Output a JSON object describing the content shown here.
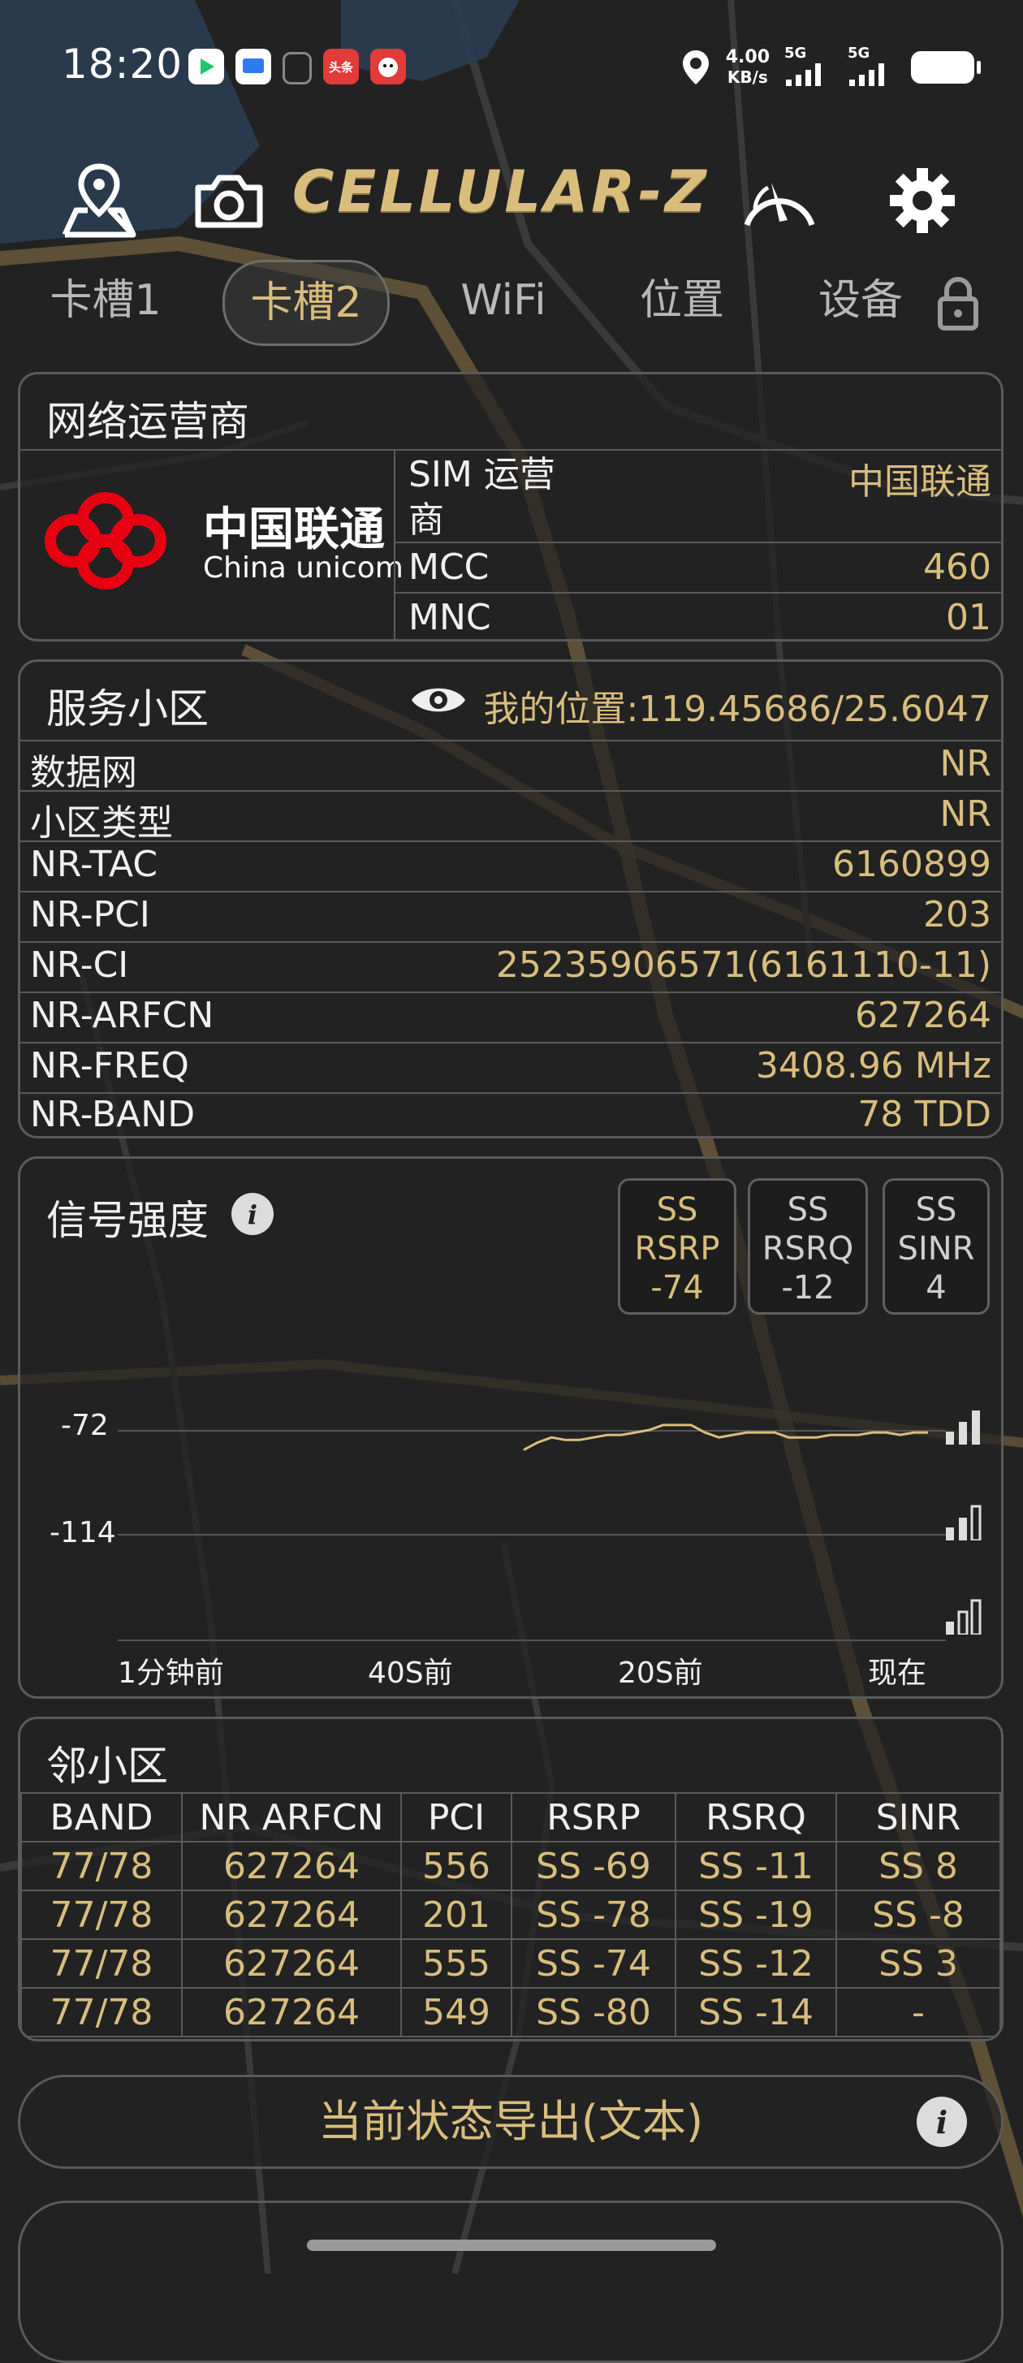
{
  "statusbar": {
    "time": "18:20",
    "speed_value": "4.00",
    "speed_unit": "KB/s",
    "sim1_net": "5G",
    "sim2_net": "5G",
    "news_app_label": "头条"
  },
  "app": {
    "brand": "CELLULAR-Z"
  },
  "tabs": [
    {
      "label": "卡槽1"
    },
    {
      "label": "卡槽2"
    },
    {
      "label": "WiFi"
    },
    {
      "label": "位置"
    },
    {
      "label": "设备"
    }
  ],
  "operator_panel": {
    "title": "网络运营商",
    "logo_cn": "中国联通",
    "logo_en": "China unicom",
    "rows": [
      {
        "label": "SIM 运营商",
        "value": "中国联通"
      },
      {
        "label": "MCC",
        "value": "460"
      },
      {
        "label": "MNC",
        "value": "01"
      }
    ]
  },
  "serving_cell": {
    "title": "服务小区",
    "location": "我的位置:119.45686/25.6047",
    "rows": [
      {
        "label": "数据网",
        "value": "NR"
      },
      {
        "label": "小区类型",
        "value": "NR"
      },
      {
        "label": "NR-TAC",
        "value": "6160899"
      },
      {
        "label": "NR-PCI",
        "value": "203"
      },
      {
        "label": "NR-CI",
        "value": "25235906571(6161110-11)"
      },
      {
        "label": "NR-ARFCN",
        "value": "627264"
      },
      {
        "label": "NR-FREQ",
        "value": "3408.96 MHz"
      },
      {
        "label": "NR-BAND",
        "value": "78 TDD"
      }
    ]
  },
  "signal": {
    "title": "信号强度",
    "boxes": [
      {
        "line1": "SS",
        "line2": "RSRP",
        "line3": "-74"
      },
      {
        "line1": "SS",
        "line2": "RSRQ",
        "line3": "-12"
      },
      {
        "line1": "SS",
        "line2": "SINR",
        "line3": "4"
      }
    ],
    "y_labels": [
      "-72",
      "-114"
    ],
    "x_labels": [
      "1分钟前",
      "40S前",
      "20S前",
      "现在"
    ],
    "line_color": "#d9bd7d"
  },
  "chart_data": {
    "type": "line",
    "ylim": [
      -156,
      -72
    ],
    "xlabels": [
      "1分钟前",
      "40S前",
      "20S前",
      "现在"
    ],
    "series": [
      {
        "values": [
          -80,
          -77,
          -75,
          -76,
          -76,
          -75,
          -74,
          -74,
          -73,
          -72,
          -70,
          -70,
          -70,
          -73,
          -75,
          -74,
          -73,
          -73,
          -73,
          -75,
          -75,
          -75,
          -74,
          -74,
          -74,
          -73,
          -73,
          -74,
          -73,
          -73
        ]
      }
    ]
  },
  "neighbors": {
    "title": "邻小区",
    "headers": [
      "BAND",
      "NR ARFCN",
      "PCI",
      "RSRP",
      "RSRQ",
      "SINR"
    ],
    "rows": [
      [
        "77/78",
        "627264",
        "556",
        "SS -69",
        "SS -11",
        "SS 8"
      ],
      [
        "77/78",
        "627264",
        "201",
        "SS -78",
        "SS -19",
        "SS -8"
      ],
      [
        "77/78",
        "627264",
        "555",
        "SS -74",
        "SS -12",
        "SS 3"
      ],
      [
        "77/78",
        "627264",
        "549",
        "SS -80",
        "SS -14",
        "-"
      ]
    ]
  },
  "export": {
    "label": "当前状态导出(文本)"
  },
  "colors": {
    "accent": "#d9bd7d",
    "background": "#222222",
    "border": "#5a5a5a"
  }
}
